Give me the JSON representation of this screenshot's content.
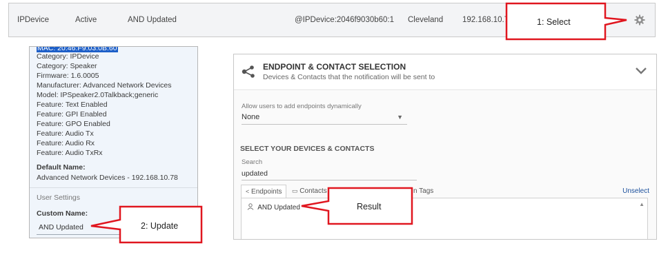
{
  "top_row": {
    "name": "IPDevice",
    "status": "Active",
    "label": "AND Updated",
    "address": "@IPDevice:2046f9030b60:1",
    "location": "Cleveland",
    "ip": "192.168.10.7",
    "settings_icon": "gear-icon"
  },
  "device_info": {
    "first_line_highlighted": "MAC: 20:46:F9:03:0B:60",
    "lines": [
      "Category: IPDevice",
      "Category: Speaker",
      "Firmware: 1.6.0005",
      "Manufacturer: Advanced Network Devices",
      "Model: IPSpeaker2.0Talkback;generic",
      "Feature: Text Enabled",
      "Feature: GPI Enabled",
      "Feature: GPO Enabled",
      "Feature: Audio Tx",
      "Feature: Audio Rx",
      "Feature: Audio TxRx"
    ],
    "default_name_label": "Default Name:",
    "default_name_value": "Advanced Network Devices - 192.168.10.78",
    "user_settings_label": "User Settings",
    "custom_name_label": "Custom Name:",
    "custom_name_value": "AND Updated"
  },
  "endpoint_panel": {
    "title": "ENDPOINT & CONTACT SELECTION",
    "subtitle": "Devices & Contacts that the notification will be sent to",
    "allow_label": "Allow users to add endpoints dynamically",
    "allow_value": "None",
    "section_title": "SELECT YOUR DEVICES & CONTACTS",
    "search_label": "Search",
    "search_value": "updated",
    "tabs": [
      {
        "label": "Endpoints",
        "icon": "share-icon"
      },
      {
        "label": "Contacts",
        "icon": "contact-card-icon"
      },
      {
        "label": "n Tags",
        "icon": ""
      }
    ],
    "unselect_label": "Unselect",
    "result_item": "AND Updated",
    "result_icon": "user-icon"
  },
  "callouts": {
    "select": "1: Select",
    "update": "2: Update",
    "result": "Result",
    "color": "#e0161f"
  }
}
